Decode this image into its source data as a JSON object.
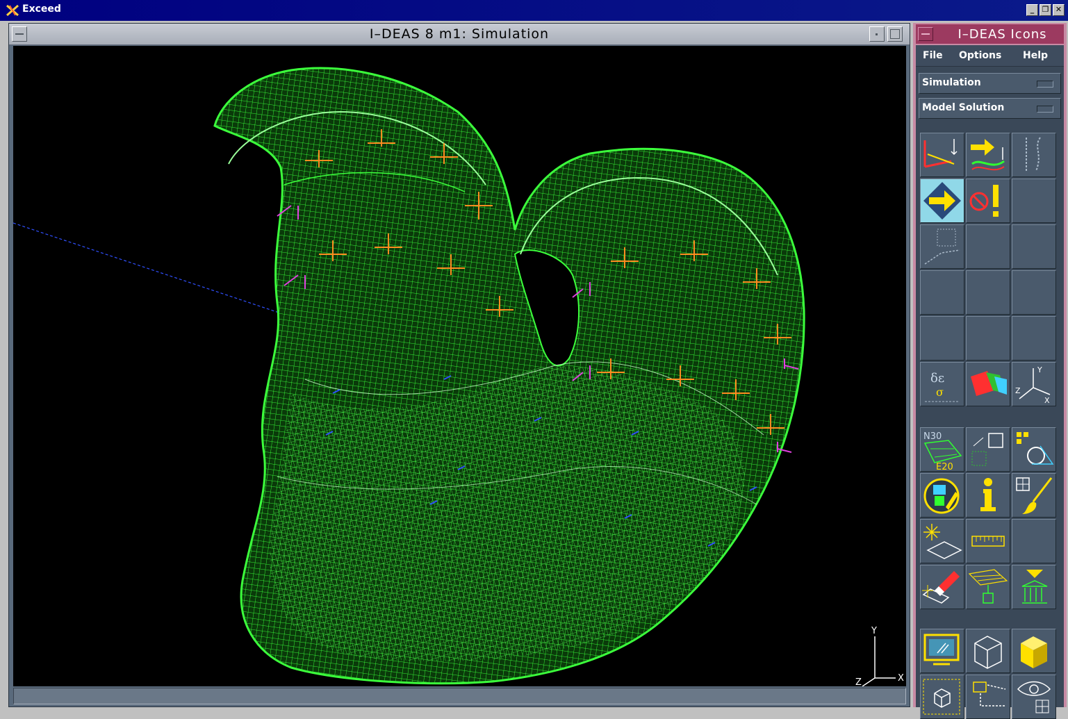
{
  "exceed": {
    "title": "Exceed"
  },
  "main_window": {
    "title": "I–DEAS 8 m1:   Simulation"
  },
  "icons_window": {
    "title": "I–DEAS Icons",
    "menu": [
      "File",
      "Options",
      "Help"
    ],
    "tasks": [
      "Simulation",
      "Model Solution"
    ],
    "icon_labels": {
      "node_elem_top": "N30",
      "node_elem_bottom": "E20"
    }
  },
  "triad": {
    "x": "X",
    "y": "Y",
    "z": "Z"
  },
  "colors": {
    "mesh": "#33ff33",
    "viewport_bg": "#000000",
    "icon_yellow": "#ffe000",
    "panel_accent": "#9c3a60"
  }
}
